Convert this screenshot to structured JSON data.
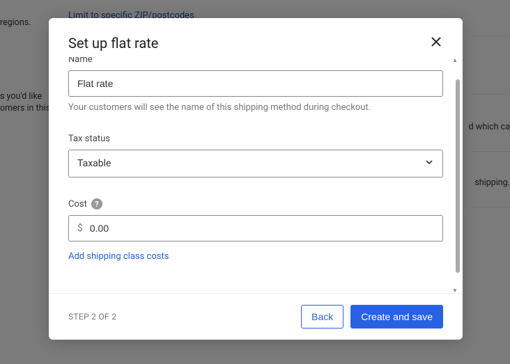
{
  "backdrop": {
    "regions_text": "regions.",
    "limit_link": "Limit to specific ZIP/postcodes",
    "youd_like": "s you'd like",
    "omers": "omers in this",
    "which_ca": "d which ca",
    "shipping": "shipping."
  },
  "modal": {
    "title": "Set up flat rate",
    "close_aria": "Close"
  },
  "form": {
    "name_label": "Name",
    "name_value": "Flat rate",
    "name_help": "Your customers will see the name of this shipping method during checkout.",
    "tax_label": "Tax status",
    "tax_value": "Taxable",
    "cost_label": "Cost",
    "cost_prefix": "$",
    "cost_value": "0.00",
    "add_shipping_link": "Add shipping class costs"
  },
  "footer": {
    "step": "STEP 2 OF 2",
    "back": "Back",
    "create": "Create and save"
  }
}
